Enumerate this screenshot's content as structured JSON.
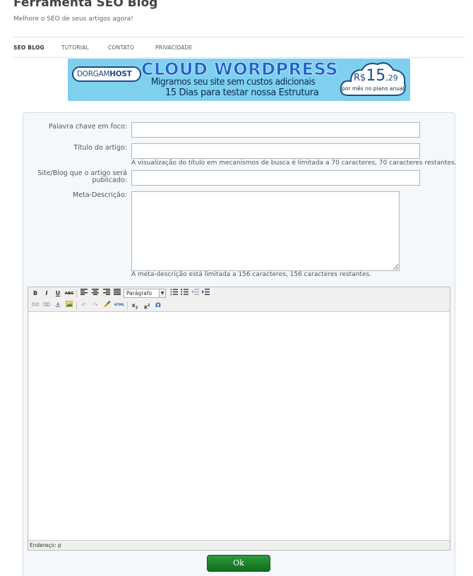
{
  "header": {
    "site_title": "Ferramenta SEO Blog",
    "tagline": "Melhore o SEO de seus artigos agora!"
  },
  "nav": {
    "items": [
      {
        "label": "SEO BLOG",
        "active": true
      },
      {
        "label": "TUTORIAL",
        "active": false
      },
      {
        "label": "CONTATO",
        "active": false
      },
      {
        "label": "PRIVACIDADE",
        "active": false
      }
    ]
  },
  "banner": {
    "logo_part1": "DORGAM",
    "logo_part2": "HOST",
    "headline": "CLOUD WORDPRESS",
    "line1": "Migramos seu site sem custos adicionais",
    "line2": "15 Dias para testar nossa Estrutura",
    "price_currency": "R$",
    "price_int": "15",
    "price_dec": ",29",
    "per_month": "por mês no plano anual",
    "background_color": "#7fd0ef"
  },
  "form": {
    "keyword_label": "Palavra chave em foco:",
    "keyword_value": "",
    "title_label": "Título do artigo:",
    "title_value": "",
    "title_hint": "A visualização do título em mecanismos de busca é limitada a 70 caracteres, 70 caracteres restantes.",
    "site_label": "Site/Blog que o artigo será publicado:",
    "site_value": "",
    "meta_label": "Meta-Descrição:",
    "meta_value": "",
    "meta_hint": "A meta-descrição está limitada a 156 caracteres, 156 caracteres restantes."
  },
  "editor": {
    "format_select": "Parágrafo",
    "status_path": "Endereço: p",
    "toolbar_row1": [
      "B",
      "I",
      "U",
      "ABC"
    ],
    "toolbar_html": "HTML"
  },
  "submit": {
    "label": "Ok",
    "color": "#1f8a2c"
  }
}
